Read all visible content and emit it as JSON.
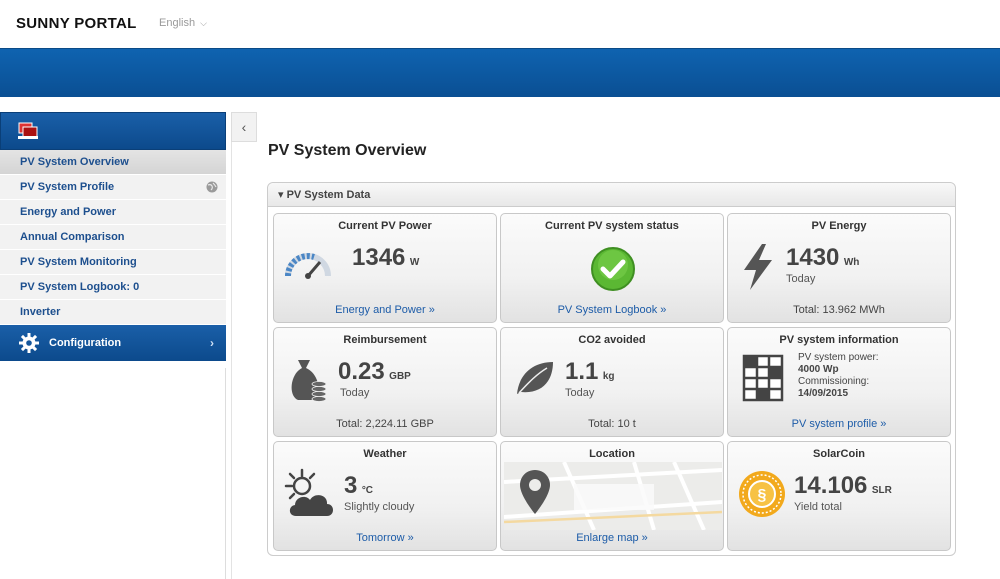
{
  "header": {
    "brand": "SUNNY PORTAL",
    "language": "English",
    "language_chevron": "⌵"
  },
  "sidebar": {
    "items": [
      {
        "label": "PV System Overview",
        "active": true
      },
      {
        "label": "PV System Profile",
        "icon": "globe-icon"
      },
      {
        "label": "Energy and Power"
      },
      {
        "label": "Annual Comparison"
      },
      {
        "label": "PV System Monitoring"
      },
      {
        "label": "PV System Logbook: 0"
      },
      {
        "label": "Inverter"
      }
    ],
    "config_label": "Configuration",
    "config_arrow": "›",
    "collapse_glyph": "‹"
  },
  "main": {
    "title": "PV System Overview",
    "panel_title": "▾ PV System Data"
  },
  "tiles": {
    "current_power": {
      "title": "Current PV Power",
      "value": "1346",
      "unit": "W",
      "link": "Energy and Power »"
    },
    "status": {
      "title": "Current PV system status",
      "link": "PV System Logbook »",
      "color": "#5bb833"
    },
    "energy": {
      "title": "PV Energy",
      "value": "1430",
      "unit": "Wh",
      "sub": "Today",
      "footer": "Total: 13.962 MWh"
    },
    "reimbursement": {
      "title": "Reimbursement",
      "value": "0.23",
      "unit": "GBP",
      "sub": "Today",
      "footer": "Total: 2,224.11 GBP"
    },
    "co2": {
      "title": "CO2 avoided",
      "value": "1.1",
      "unit": "kg",
      "sub": "Today",
      "footer": "Total: 10 t"
    },
    "info": {
      "title": "PV system information",
      "power_label": "PV system power:",
      "power_value": "4000 Wp",
      "commission_label": "Commissioning:",
      "commission_value": "14/09/2015",
      "link": "PV system profile »"
    },
    "weather": {
      "title": "Weather",
      "value": "3",
      "unit": "°C",
      "sub": "Slightly cloudy",
      "link": "Tomorrow »"
    },
    "location": {
      "title": "Location",
      "link": "Enlarge map »"
    },
    "solarcoin": {
      "title": "SolarCoin",
      "value": "14.106",
      "unit": "SLR",
      "sub": "Yield total",
      "color": "#f2a91c"
    }
  },
  "colors": {
    "brand_blue": "#0f5ea8",
    "link": "#1d5ca8"
  }
}
